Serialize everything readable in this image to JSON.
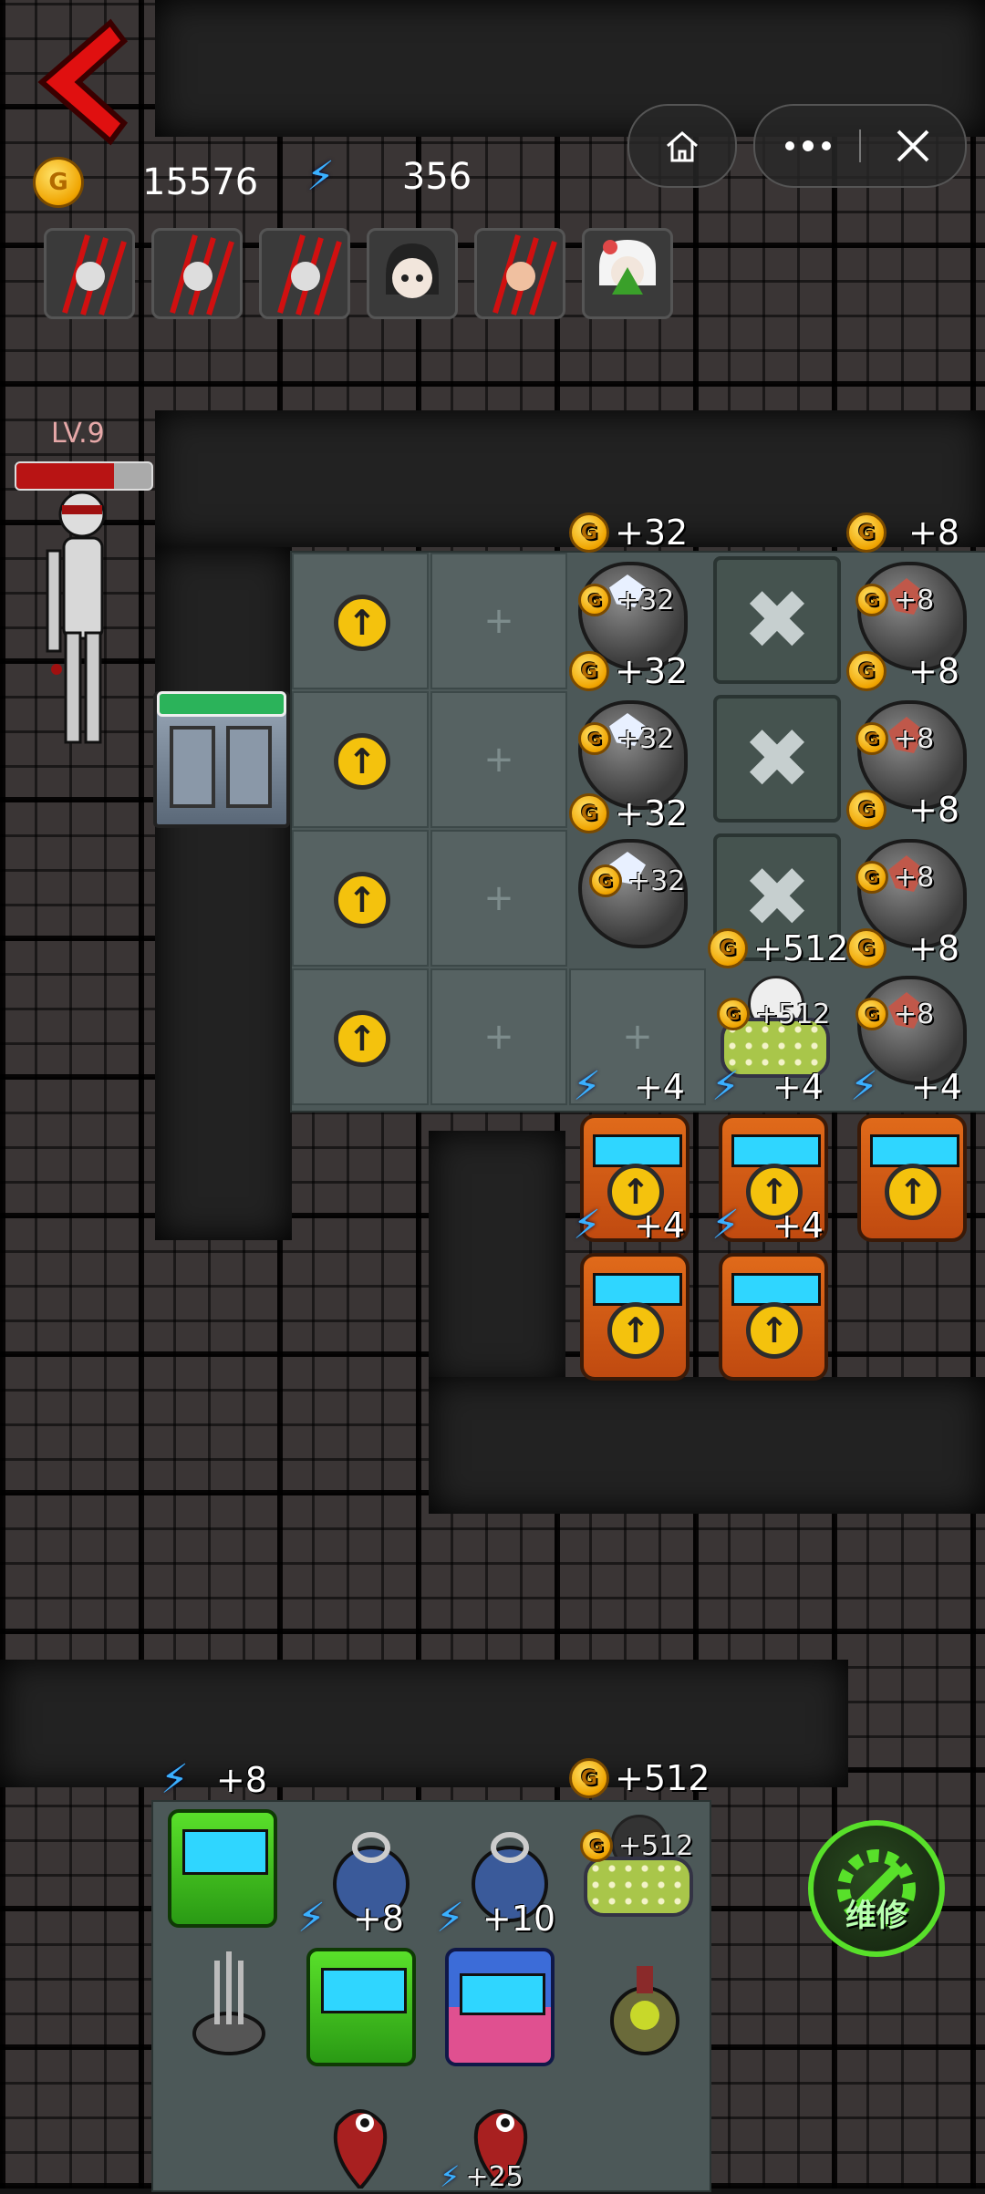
{
  "header": {
    "gold_amount": "15576",
    "energy_amount": "356",
    "gold_icon_letter": "G"
  },
  "window_controls": [
    "home-icon",
    "more-icon",
    "close-icon"
  ],
  "player": {
    "level": "LV.9",
    "hp_fraction": 0.72
  },
  "repair_button": {
    "label": "维修"
  },
  "portrait_slots": [
    "claw-attack",
    "claw-attack",
    "claw-attack",
    "girl-face",
    "claw-attack",
    "ghost-girl"
  ],
  "bonuses": {
    "gold_32": "+32",
    "gold_8": "+8",
    "gold_512": "+512",
    "energy_4": "+4",
    "energy_8": "+8",
    "energy_10": "+10",
    "energy_25": "+25",
    "empty_plus": "+"
  },
  "colors": {
    "gold": "#f0a400",
    "energy": "#3ab0ff",
    "upgrade": "#f4c20d",
    "hp": "#b81414",
    "repair": "#58e02a"
  }
}
